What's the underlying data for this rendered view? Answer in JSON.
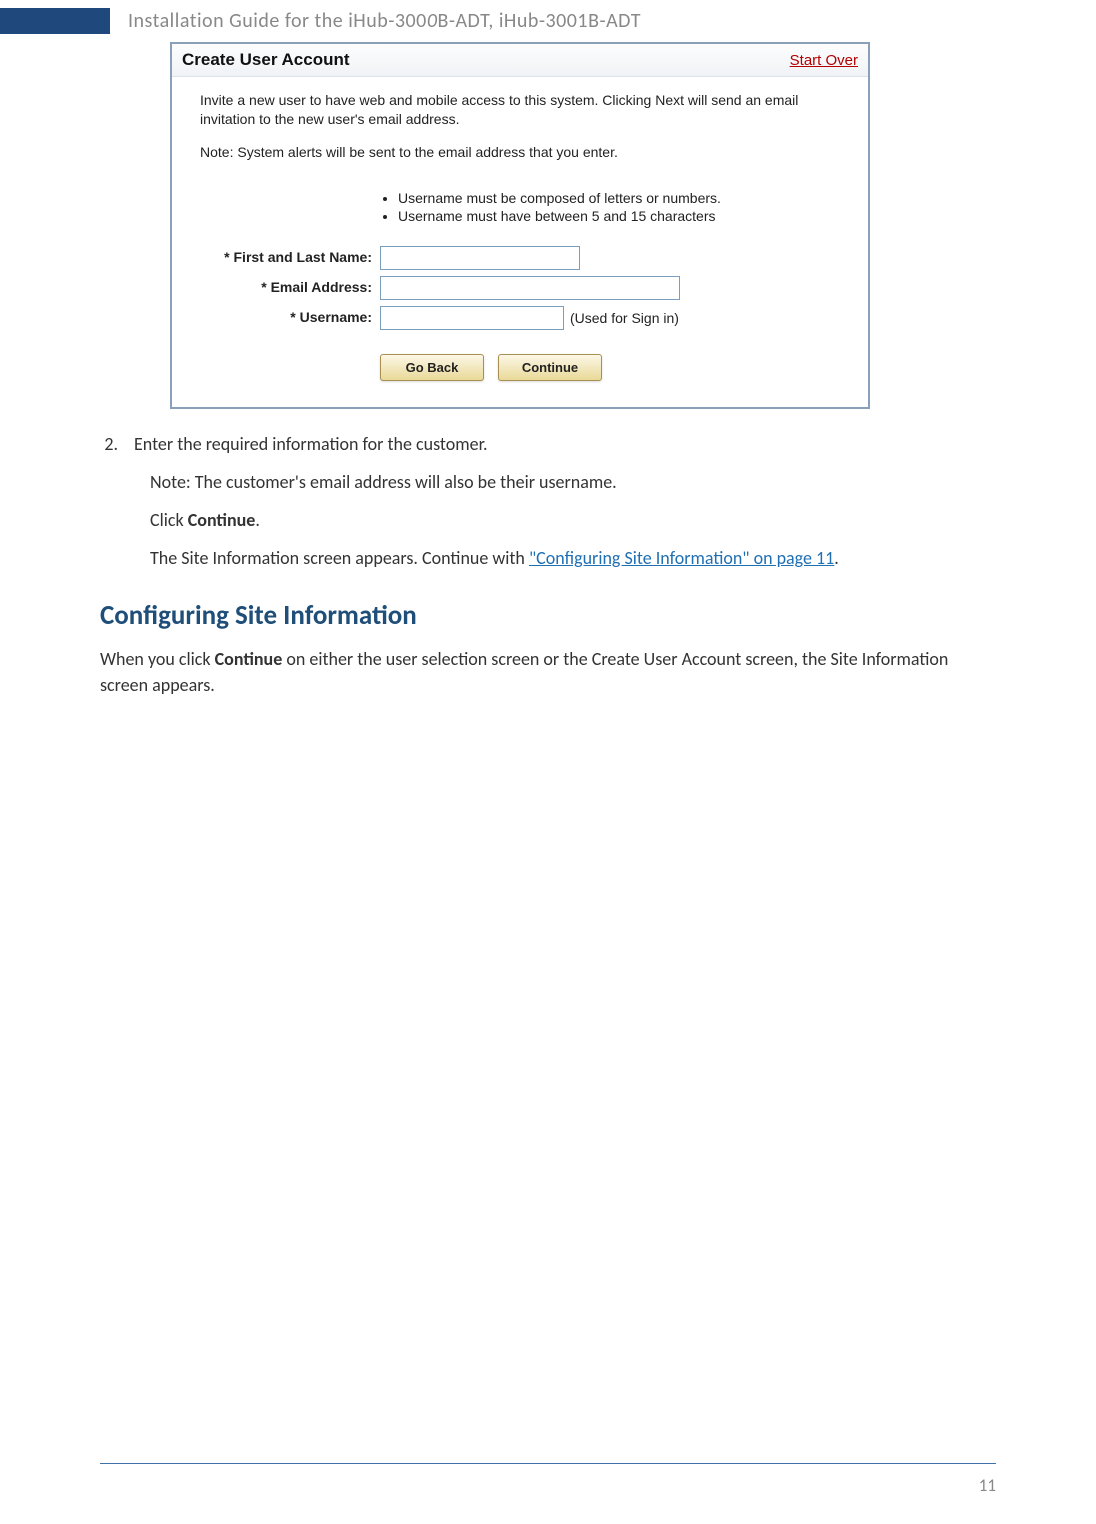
{
  "header": {
    "doc_title_prefix": "Installation Guide for the iHub-300",
    "doc_title_italic": "0",
    "doc_title_suffix": "B-ADT, iHub-3001B-ADT"
  },
  "screenshot": {
    "title": "Create User Account",
    "start_over": "Start Over",
    "intro1": "Invite a new user to have web and mobile access to this system. Clicking Next will send an email invitation to the new user's email address.",
    "intro2": "Note: System alerts will be sent to the email address that you enter.",
    "rules": [
      "Username must be composed of letters or numbers.",
      "Username must have between 5 and 15 characters"
    ],
    "fields": {
      "name_label": "* First and Last Name:",
      "email_label": "* Email Address:",
      "username_label": "* Username:",
      "username_hint": "(Used for Sign in)"
    },
    "buttons": {
      "go_back": "Go Back",
      "continue": "Continue"
    }
  },
  "instructions": {
    "step_num": "2.",
    "step_text": "Enter the required information for the customer.",
    "note": "Note: The customer's email address will also be their username.",
    "click_prefix": "Click ",
    "click_bold": "Continue",
    "click_suffix": ".",
    "result_prefix": "The Site Information screen appears. Continue with ",
    "result_link": "\"Configuring Site Information\" on page 11",
    "result_suffix": "."
  },
  "section": {
    "heading": "Configuring Site Information",
    "para_prefix": "When you click ",
    "para_bold": "Continue",
    "para_suffix": " on either the user selection screen or the Create User Account screen, the Site Information screen appears."
  },
  "footer": {
    "page_number": "11"
  }
}
